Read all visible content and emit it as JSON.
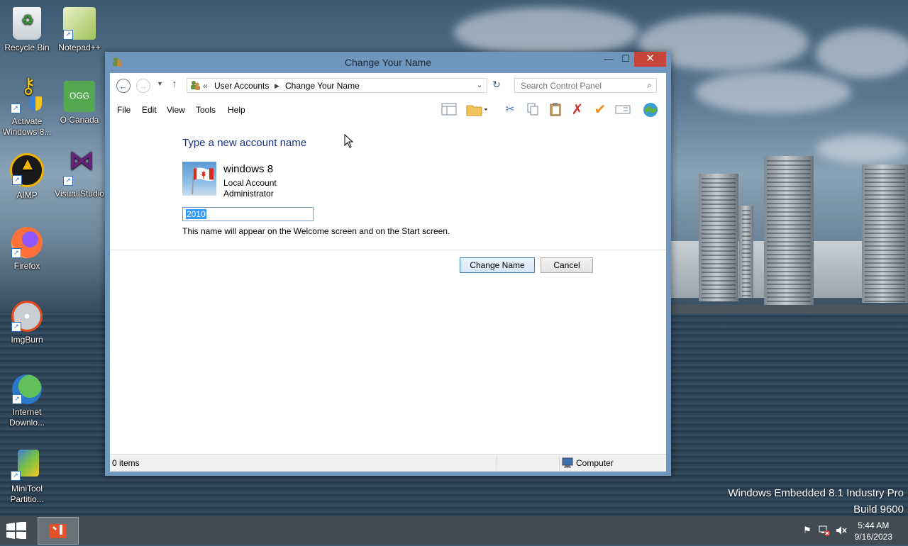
{
  "desktop": {
    "icons": [
      {
        "label": "Recycle Bin"
      },
      {
        "label": "Notepad++"
      },
      {
        "label": "Activate Windows 8..."
      },
      {
        "label": "O Canada",
        "badge": "OGG"
      },
      {
        "label": "AIMP"
      },
      {
        "label": "Visual Studio"
      },
      {
        "label": "Firefox"
      },
      {
        "label": "ImgBurn"
      },
      {
        "label": "Internet Downlo..."
      },
      {
        "label": "MiniTool Partitio..."
      }
    ],
    "watermark": {
      "line1": "Windows Embedded 8.1 Industry Pro",
      "line2": "Build 9600"
    }
  },
  "window": {
    "title": "Change Your Name",
    "controls": {
      "minimize": "—",
      "maximize": "☐",
      "close": "✕"
    },
    "address": {
      "overflow": "«",
      "crumbs": [
        "User Accounts",
        "Change Your Name"
      ]
    },
    "search": {
      "placeholder": "Search Control Panel"
    },
    "menu": [
      "File",
      "Edit",
      "View",
      "Tools",
      "Help"
    ],
    "content": {
      "heading": "Type a new account name",
      "account_name": "windows 8",
      "account_type": "Local Account",
      "account_role": "Administrator",
      "new_name_value": "2010",
      "hint": "This name will appear on the Welcome screen and on the Start screen.",
      "primary_button": "Change Name",
      "cancel_button": "Cancel"
    },
    "status": {
      "items": "0 items",
      "location": "Computer"
    }
  },
  "taskbar": {
    "clock_time": "5:44 AM",
    "clock_date": "9/16/2023"
  },
  "colors": {
    "heading": "#1e3287",
    "close": "#c7443a",
    "accent": "#3399ff"
  }
}
